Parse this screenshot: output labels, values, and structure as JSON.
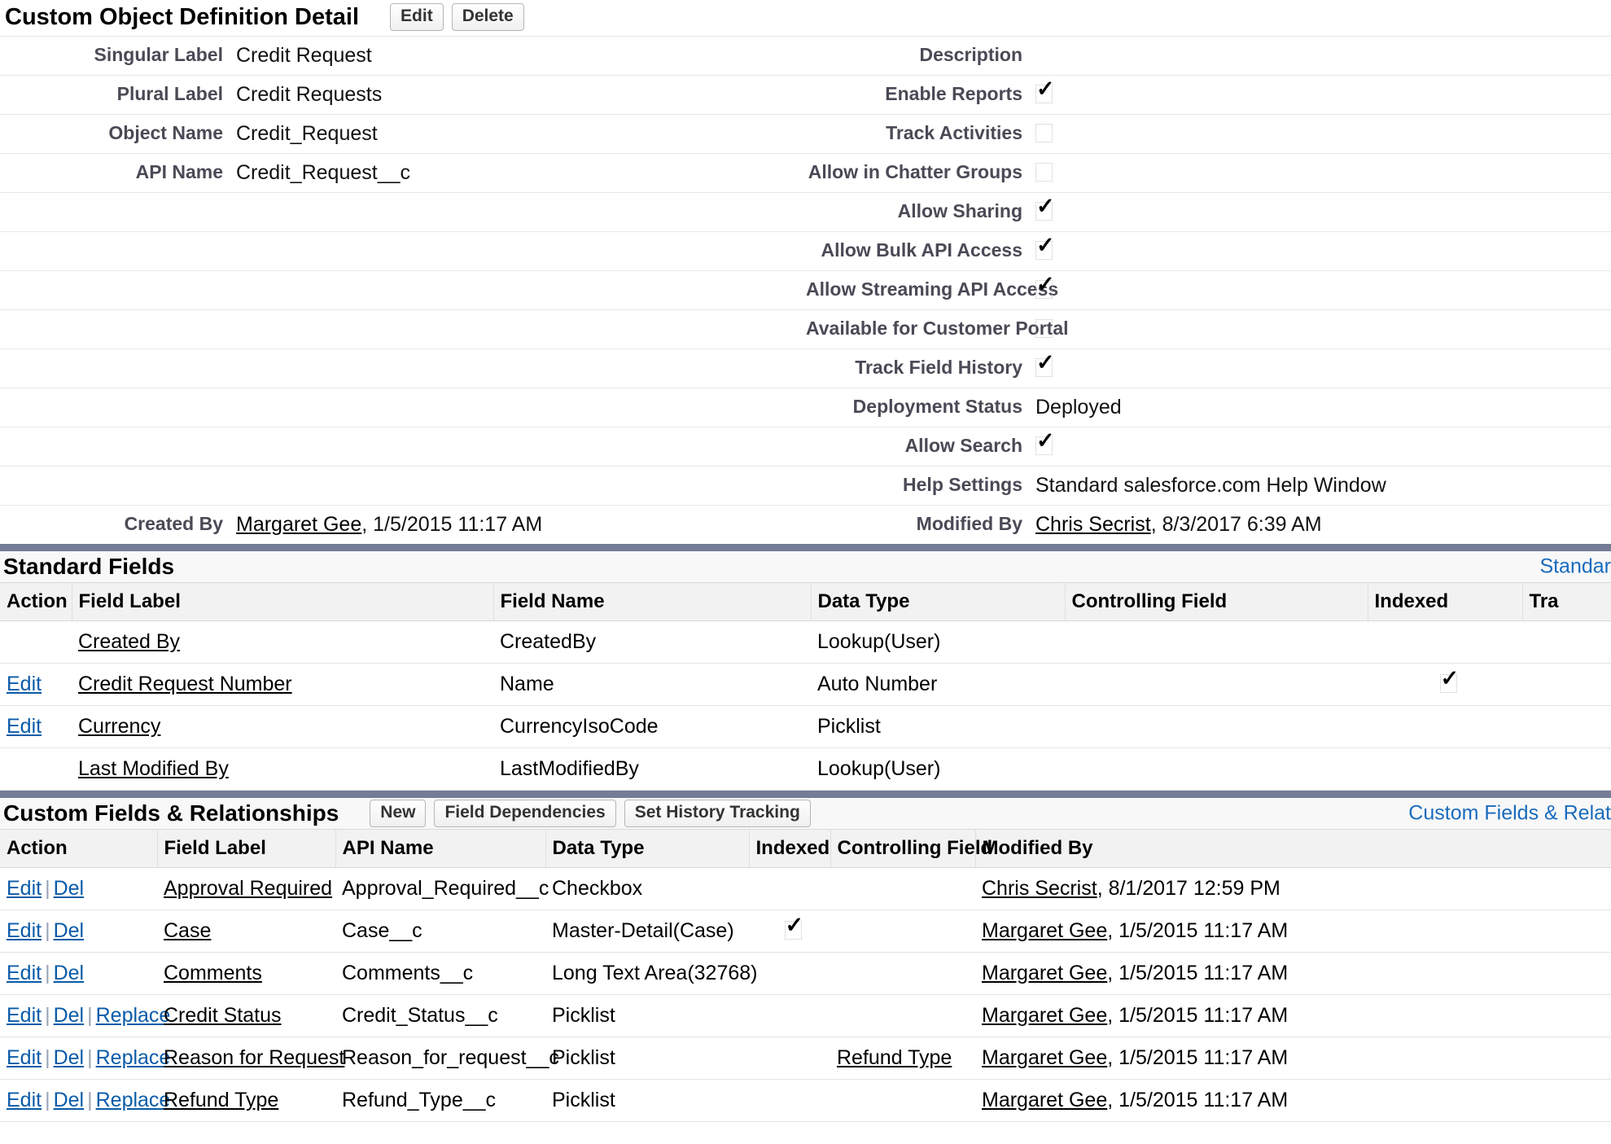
{
  "detail": {
    "title": "Custom Object Definition Detail",
    "buttons": [
      {
        "label": "Edit",
        "name": "edit-button"
      },
      {
        "label": "Delete",
        "name": "delete-button"
      }
    ],
    "left_fields": [
      {
        "label": "Singular Label",
        "value": "Credit Request",
        "type": "text"
      },
      {
        "label": "Plural Label",
        "value": "Credit Requests",
        "type": "text"
      },
      {
        "label": "Object Name",
        "value": "Credit_Request",
        "type": "text"
      },
      {
        "label": "API Name",
        "value": "Credit_Request__c",
        "type": "text"
      },
      {
        "label": "",
        "value": "",
        "type": "text"
      },
      {
        "label": "",
        "value": "",
        "type": "text"
      },
      {
        "label": "",
        "value": "",
        "type": "text"
      },
      {
        "label": "",
        "value": "",
        "type": "text"
      },
      {
        "label": "",
        "value": "",
        "type": "text"
      },
      {
        "label": "",
        "value": "",
        "type": "text"
      },
      {
        "label": "",
        "value": "",
        "type": "text"
      },
      {
        "label": "",
        "value": "",
        "type": "text"
      }
    ],
    "right_fields": [
      {
        "label": "Description",
        "value": "",
        "type": "text"
      },
      {
        "label": "Enable Reports",
        "value": "",
        "type": "checkbox",
        "checked": true
      },
      {
        "label": "Track Activities",
        "value": "",
        "type": "checkbox",
        "checked": false
      },
      {
        "label": "Allow in Chatter Groups",
        "value": "",
        "type": "checkbox",
        "checked": false
      },
      {
        "label": "Allow Sharing",
        "value": "",
        "type": "checkbox",
        "checked": true
      },
      {
        "label": "Allow Bulk API Access",
        "value": "",
        "type": "checkbox",
        "checked": true
      },
      {
        "label": "Allow Streaming API Access",
        "value": "",
        "type": "checkbox",
        "checked": true
      },
      {
        "label": "Available for Customer Portal",
        "value": "",
        "type": "checkbox",
        "checked": false
      },
      {
        "label": "Track Field History",
        "value": "",
        "type": "checkbox",
        "checked": true
      },
      {
        "label": "Deployment Status",
        "value": "Deployed",
        "type": "text"
      },
      {
        "label": "Allow Search",
        "value": "",
        "type": "checkbox",
        "checked": true
      },
      {
        "label": "Help Settings",
        "value": "Standard salesforce.com Help Window",
        "type": "text"
      }
    ],
    "created_by": {
      "label": "Created By",
      "user": "Margaret Gee",
      "timestamp": ", 1/5/2015 11:17 AM"
    },
    "modified_by": {
      "label": "Modified By",
      "user": "Chris Secrist",
      "timestamp": ", 8/3/2017 6:39 AM"
    }
  },
  "standard_fields": {
    "title": "Standard Fields",
    "right_link": "Standar",
    "columns": [
      "Action",
      "Field Label",
      "Field Name",
      "Data Type",
      "Controlling Field",
      "Indexed",
      "Tra"
    ],
    "rows": [
      {
        "action": "",
        "field_label": "Created By",
        "field_name": "CreatedBy",
        "data_type": "Lookup(User)",
        "controlling_field": "",
        "indexed": false,
        "tracked": ""
      },
      {
        "action": "Edit",
        "field_label": "Credit Request Number",
        "field_name": "Name",
        "data_type": "Auto Number",
        "controlling_field": "",
        "indexed": true,
        "tracked": ""
      },
      {
        "action": "Edit",
        "field_label": "Currency",
        "field_name": "CurrencyIsoCode",
        "data_type": "Picklist",
        "controlling_field": "",
        "indexed": false,
        "tracked": ""
      },
      {
        "action": "",
        "field_label": "Last Modified By",
        "field_name": "LastModifiedBy",
        "data_type": "Lookup(User)",
        "controlling_field": "",
        "indexed": false,
        "tracked": ""
      }
    ]
  },
  "custom_fields": {
    "title": "Custom Fields & Relationships",
    "right_link": "Custom Fields & Relat",
    "buttons": [
      {
        "label": "New",
        "name": "new-field-button"
      },
      {
        "label": "Field Dependencies",
        "name": "field-dependencies-button"
      },
      {
        "label": "Set History Tracking",
        "name": "set-history-tracking-button"
      }
    ],
    "columns": [
      "Action",
      "Field Label",
      "API Name",
      "Data Type",
      "Indexed",
      "Controlling Field",
      "Modified By"
    ],
    "rows": [
      {
        "actions": [
          "Edit",
          "Del"
        ],
        "field_label": "Approval Required",
        "api_name": "Approval_Required__c",
        "data_type": "Checkbox",
        "indexed": false,
        "controlling_field": "",
        "modified_user": "Chris Secrist",
        "modified_time": ", 8/1/2017 12:59 PM"
      },
      {
        "actions": [
          "Edit",
          "Del"
        ],
        "field_label": "Case",
        "api_name": "Case__c",
        "data_type": "Master-Detail(Case)",
        "indexed": true,
        "controlling_field": "",
        "modified_user": "Margaret Gee",
        "modified_time": ", 1/5/2015 11:17 AM"
      },
      {
        "actions": [
          "Edit",
          "Del"
        ],
        "field_label": "Comments",
        "api_name": "Comments__c",
        "data_type": "Long Text Area(32768)",
        "indexed": false,
        "controlling_field": "",
        "modified_user": "Margaret Gee",
        "modified_time": ", 1/5/2015 11:17 AM"
      },
      {
        "actions": [
          "Edit",
          "Del",
          "Replace"
        ],
        "field_label": "Credit Status",
        "api_name": "Credit_Status__c",
        "data_type": "Picklist",
        "indexed": false,
        "controlling_field": "",
        "modified_user": "Margaret Gee",
        "modified_time": ", 1/5/2015 11:17 AM"
      },
      {
        "actions": [
          "Edit",
          "Del",
          "Replace"
        ],
        "field_label": "Reason for Request",
        "api_name": "Reason_for_request__c",
        "data_type": "Picklist",
        "indexed": false,
        "controlling_field": "Refund Type",
        "modified_user": "Margaret Gee",
        "modified_time": ", 1/5/2015 11:17 AM"
      },
      {
        "actions": [
          "Edit",
          "Del",
          "Replace"
        ],
        "field_label": "Refund Type",
        "api_name": "Refund_Type__c",
        "data_type": "Picklist",
        "indexed": false,
        "controlling_field": "",
        "modified_user": "Margaret Gee",
        "modified_time": ", 1/5/2015 11:17 AM"
      }
    ]
  },
  "colors": {
    "divider": "#747c96",
    "link": "#0a5ba8",
    "section_link": "#1a6bbd",
    "label": "#4a4a56"
  }
}
